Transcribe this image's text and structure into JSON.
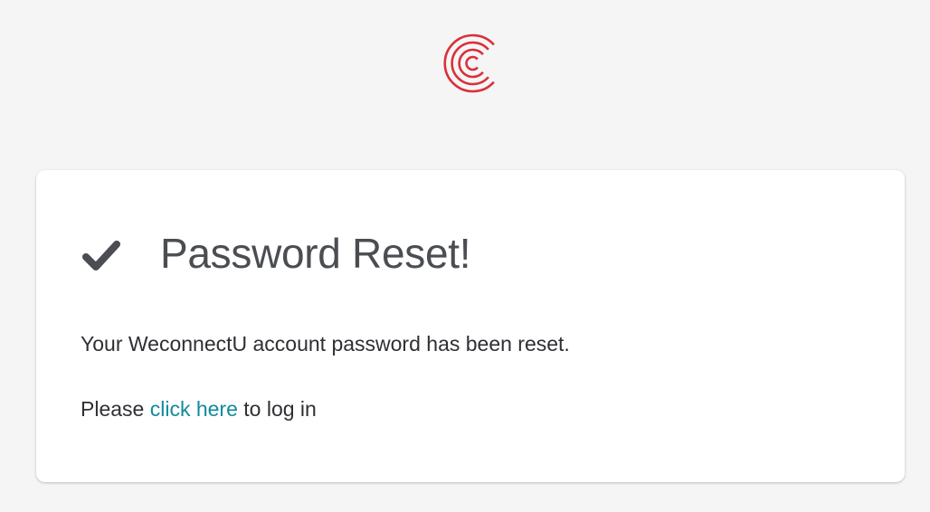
{
  "brand": {
    "logo_icon": "weconnectu-c-logo-icon",
    "logo_color": "#d9303a"
  },
  "card": {
    "icon": "checkmark-icon",
    "icon_color": "#4a4d52",
    "title": "Password Reset!",
    "message": "Your WeconnectU account password has been reset.",
    "login_prefix": "Please ",
    "login_link_label": "click here",
    "login_suffix": " to log in",
    "link_color": "#128a9c"
  }
}
